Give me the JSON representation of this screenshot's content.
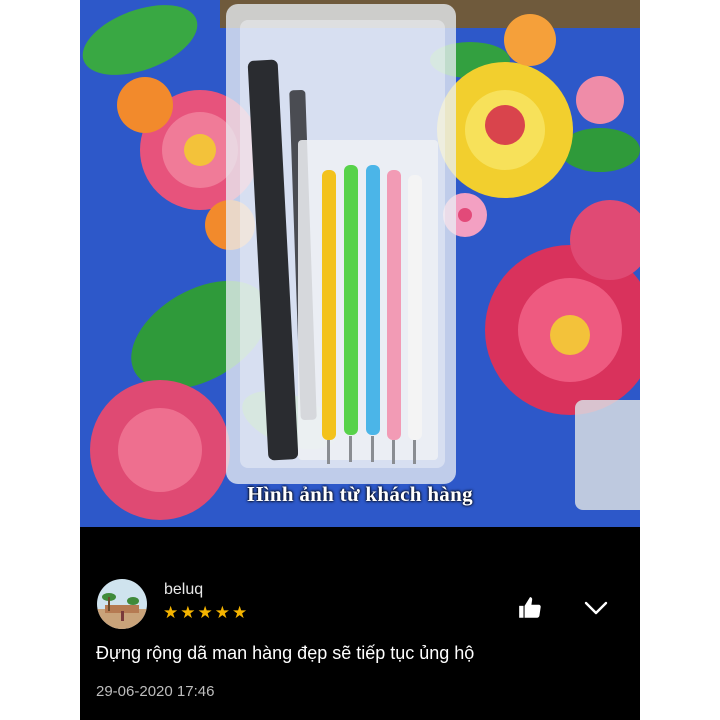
{
  "photo": {
    "caption": "Hình ảnh từ khách hàng"
  },
  "review": {
    "username": "beluq",
    "rating": 5,
    "rating_max": 5,
    "stars": [
      "★",
      "★",
      "★",
      "★",
      "★"
    ],
    "star_color": "#f5b400",
    "comment": "Đựng rộng dã man hàng đẹp sẽ tiếp tục ủng hộ",
    "timestamp": "29-06-2020 17:46",
    "actions": {
      "like_icon": "thumbs-up-icon",
      "expand_icon": "chevron-down-icon"
    }
  },
  "colors": {
    "background": "#000000",
    "text": "#ffffff",
    "muted_text": "#bdbdbd",
    "fabric_blue": "#2a55c8"
  }
}
